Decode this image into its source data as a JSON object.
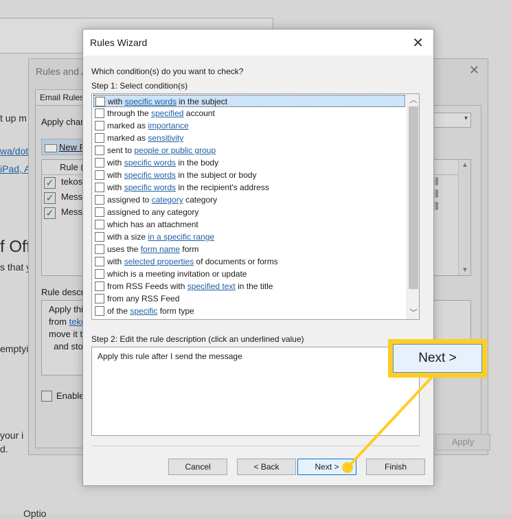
{
  "background": {
    "fragments": [
      {
        "text": "t up m",
        "link": false
      },
      {
        "text": "wa/dot",
        "link": true
      },
      {
        "text": "iPad, A",
        "link": true
      },
      {
        "text": "f Off",
        "link": false
      },
      {
        "text": "s that y",
        "link": false
      },
      {
        "text": "emptyi",
        "link": false
      },
      {
        "text": "your i",
        "link": false
      },
      {
        "text": "d.",
        "link": false
      },
      {
        "text": "Optio",
        "link": false
      }
    ]
  },
  "rules_alerts": {
    "title": "Rules and A",
    "tab": "Email Rules",
    "apply_changes": "Apply char",
    "new_rule": "New R",
    "rule_column": "Rule (",
    "rows": [
      "tekosh",
      "Messa",
      "Messa"
    ],
    "description_label": "Rule descr",
    "description_lines": [
      {
        "text": "Apply thi",
        "link": ""
      },
      {
        "text": "from ",
        "link": "teko"
      },
      {
        "text": "move it t",
        "link": ""
      },
      {
        "text": "  and sto",
        "link": ""
      }
    ],
    "enable": "Enable",
    "apply_button": "Apply"
  },
  "wizard": {
    "title": "Rules Wizard",
    "question": "Which condition(s) do you want to check?",
    "step1": "Step 1: Select condition(s)",
    "conditions": [
      {
        "pre": "with ",
        "link": "specific words",
        "post": " in the subject"
      },
      {
        "pre": "through the ",
        "link": "specified",
        "post": " account"
      },
      {
        "pre": "marked as ",
        "link": "importance",
        "post": ""
      },
      {
        "pre": "marked as ",
        "link": "sensitivity",
        "post": ""
      },
      {
        "pre": "sent to ",
        "link": "people or public group",
        "post": ""
      },
      {
        "pre": "with ",
        "link": "specific words",
        "post": " in the body"
      },
      {
        "pre": "with ",
        "link": "specific words",
        "post": " in the subject or body"
      },
      {
        "pre": "with ",
        "link": "specific words",
        "post": " in the recipient's address"
      },
      {
        "pre": "assigned to ",
        "link": "category",
        "post": " category"
      },
      {
        "pre": "assigned to any category",
        "link": "",
        "post": ""
      },
      {
        "pre": "which has an attachment",
        "link": "",
        "post": ""
      },
      {
        "pre": "with a size ",
        "link": "in a specific range",
        "post": ""
      },
      {
        "pre": "uses the ",
        "link": "form name",
        "post": " form"
      },
      {
        "pre": "with ",
        "link": "selected properties",
        "post": " of documents or forms"
      },
      {
        "pre": "which is a meeting invitation or update",
        "link": "",
        "post": ""
      },
      {
        "pre": "from RSS Feeds with ",
        "link": "specified text",
        "post": " in the title"
      },
      {
        "pre": "from any RSS Feed",
        "link": "",
        "post": ""
      },
      {
        "pre": "of the ",
        "link": "specific",
        "post": " form type"
      }
    ],
    "step2": "Step 2: Edit the rule description (click an underlined value)",
    "description": "Apply this rule after I send the message",
    "buttons": {
      "cancel": "Cancel",
      "back": "< Back",
      "next": "Next >",
      "finish": "Finish"
    }
  },
  "callout": {
    "label": "Next >",
    "color": "#ffcd22"
  },
  "colors": {
    "link": "#1f5fa6",
    "selection": "#cde3f7",
    "primary_button_border": "#0078d7"
  }
}
